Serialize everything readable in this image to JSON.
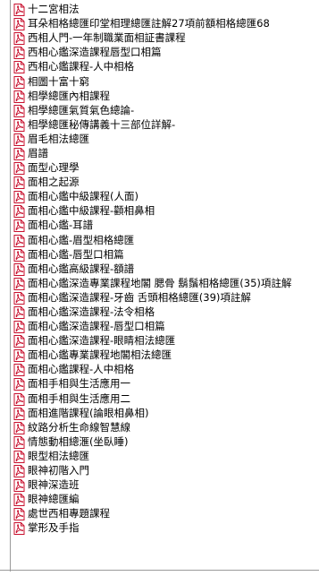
{
  "file_list": {
    "items": [
      {
        "label": "十二宮相法",
        "icon": "pdf-file-icon"
      },
      {
        "label": "耳朵相格總匯印堂相理總匯註解27項前額相格總匯68",
        "icon": "pdf-file-icon"
      },
      {
        "label": "西相人門-一年制職業面相証書課程",
        "icon": "pdf-file-icon"
      },
      {
        "label": "西相心鑑深造課程唇型口相篇",
        "icon": "pdf-file-icon"
      },
      {
        "label": "西相心鑑課程-人中相格",
        "icon": "pdf-file-icon"
      },
      {
        "label": "相圖十富十窮",
        "icon": "pdf-file-icon"
      },
      {
        "label": "相學總匯內相課程",
        "icon": "pdf-file-icon"
      },
      {
        "label": "相學總匯氣質氣色總論-",
        "icon": "pdf-file-icon"
      },
      {
        "label": "相學總匯秘傳講義十三部位詳解-",
        "icon": "pdf-file-icon"
      },
      {
        "label": "眉毛相法總匯",
        "icon": "pdf-file-icon"
      },
      {
        "label": "眉譜",
        "icon": "pdf-file-icon"
      },
      {
        "label": "面型心理學",
        "icon": "pdf-file-icon"
      },
      {
        "label": "面相之起源",
        "icon": "pdf-file-icon"
      },
      {
        "label": "面相心鑑中級課程(人面)",
        "icon": "pdf-file-icon"
      },
      {
        "label": "面相心鑑中級課程-顴相鼻相",
        "icon": "pdf-file-icon"
      },
      {
        "label": "面相心鑑-耳譜",
        "icon": "pdf-file-icon"
      },
      {
        "label": "面相心鑑-眉型相格總匯",
        "icon": "pdf-file-icon"
      },
      {
        "label": "面相心鑑-唇型口相篇",
        "icon": "pdf-file-icon"
      },
      {
        "label": "面相心鑑高級課程-額譜",
        "icon": "pdf-file-icon"
      },
      {
        "label": "面相心鑑深造專業課程地閣 腮骨 鬍鬚相格總匯(35)項註解",
        "icon": "pdf-file-icon"
      },
      {
        "label": "面相心鑑深造課程-牙齒 舌頭相格總匯(39)項註解",
        "icon": "pdf-file-icon"
      },
      {
        "label": "面相心鑑深造課程-法令相格",
        "icon": "pdf-file-icon"
      },
      {
        "label": "面相心鑑深造課程-唇型口相篇",
        "icon": "pdf-file-icon"
      },
      {
        "label": "面相心鑑深造課程-眼睛相法總匯",
        "icon": "pdf-file-icon"
      },
      {
        "label": "面相心鑑專業課程地閣相法總匯",
        "icon": "pdf-file-icon"
      },
      {
        "label": "面相心鑑課程-人中相格",
        "icon": "pdf-file-icon"
      },
      {
        "label": "面相手相與生活應用一",
        "icon": "pdf-file-icon"
      },
      {
        "label": "面相手相與生活應用二",
        "icon": "pdf-file-icon"
      },
      {
        "label": "面相進階課程(論眼相鼻相)",
        "icon": "pdf-file-icon"
      },
      {
        "label": "紋路分析生命線智慧線",
        "icon": "pdf-file-icon"
      },
      {
        "label": "情態動相總滙(坐臥睡)",
        "icon": "pdf-file-icon"
      },
      {
        "label": "眼型相法總匯",
        "icon": "pdf-file-icon"
      },
      {
        "label": "眼神初階入門",
        "icon": "pdf-file-icon"
      },
      {
        "label": "眼神深造班",
        "icon": "pdf-file-icon"
      },
      {
        "label": "眼神總匯編",
        "icon": "pdf-file-icon"
      },
      {
        "label": "處世西相專題課程",
        "icon": "pdf-file-icon"
      },
      {
        "label": "掌形及手指",
        "icon": "pdf-file-icon"
      }
    ]
  },
  "colors": {
    "pdf_red": "#c8102e",
    "guide_line": "#9a9a9a",
    "background": "#ffffff"
  }
}
